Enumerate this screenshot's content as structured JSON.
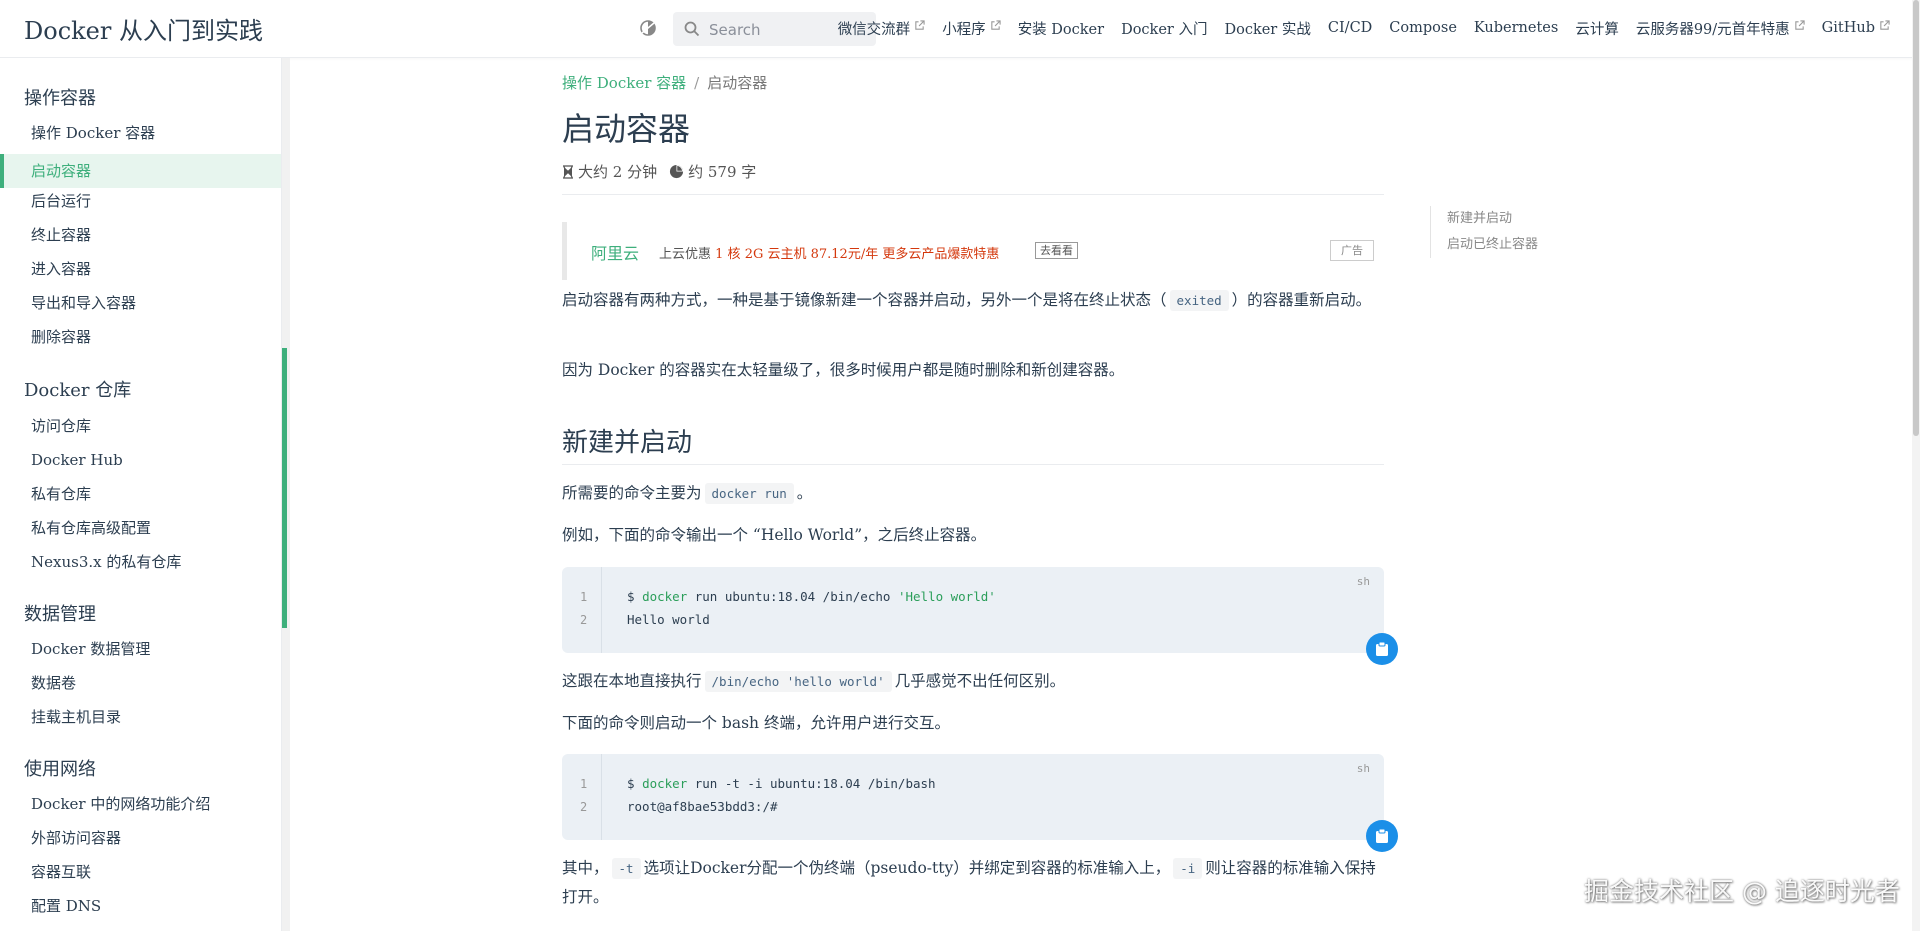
{
  "navbar": {
    "site_name": "Docker 从入门到实践",
    "search_placeholder": "Search",
    "links": [
      {
        "label": "微信交流群",
        "external": true
      },
      {
        "label": "小程序",
        "external": true
      },
      {
        "label": "安装 Docker",
        "external": false
      },
      {
        "label": "Docker 入门",
        "external": false
      },
      {
        "label": "Docker 实战",
        "external": false
      },
      {
        "label": "CI/CD",
        "external": false
      },
      {
        "label": "Compose",
        "external": false
      },
      {
        "label": "Kubernetes",
        "external": false
      },
      {
        "label": "云计算",
        "external": false
      },
      {
        "label": "云服务器99/元首年特惠",
        "external": true
      },
      {
        "label": "GitHub",
        "external": true
      }
    ]
  },
  "sidebar": {
    "groups": [
      {
        "title": "操作容器",
        "items": [
          "操作 Docker 容器",
          "启动容器",
          "后台运行",
          "终止容器",
          "进入容器",
          "导出和导入容器",
          "删除容器"
        ]
      },
      {
        "title": "Docker 仓库",
        "items": [
          "访问仓库",
          "Docker Hub",
          "私有仓库",
          "私有仓库高级配置",
          "Nexus3.x 的私有仓库"
        ]
      },
      {
        "title": "数据管理",
        "items": [
          "Docker 数据管理",
          "数据卷",
          "挂载主机目录"
        ]
      },
      {
        "title": "使用网络",
        "items": [
          "Docker 中的网络功能介绍",
          "外部访问容器",
          "容器互联",
          "配置 DNS"
        ]
      }
    ],
    "active_item": "启动容器"
  },
  "breadcrumb": {
    "parent": "操作 Docker 容器",
    "separator": "/",
    "current": "启动容器"
  },
  "page": {
    "title": "启动容器",
    "read_time": "大约 2 分钟",
    "word_count": "约 579 字"
  },
  "ad": {
    "brand": "阿里云",
    "lead": "上云优惠",
    "highlight": "1 核 2G 云主机 87.12元/年 更多云产品爆款特惠",
    "button": "去看看",
    "tag": "广告"
  },
  "body": {
    "p1_a": "启动容器有两种方式，一种是基于镜像新建一个容器并启动，另外一个是将在终止状态（",
    "p1_code": "exited",
    "p1_b": "）的容器重新启动。",
    "p2": "因为 Docker 的容器实在太轻量级了，很多时候用户都是随时删除和新创建容器。",
    "h2_new": "新建并启动",
    "p3_a": "所需要的命令主要为",
    "p3_code": "docker run",
    "p3_b": "。",
    "p4": "例如，下面的命令输出一个 “Hello World”，之后终止容器。",
    "code1": {
      "lang": "sh",
      "line_numbers": [
        "1",
        "2"
      ],
      "l1_prompt": "$ ",
      "l1_cmd": "docker",
      "l1_rest": " run ubuntu:18.04 /bin/echo ",
      "l1_str": "'Hello world'",
      "l2": "Hello world"
    },
    "p5_a": "这跟在本地直接执行",
    "p5_code": "/bin/echo 'hello world'",
    "p5_b": "几乎感觉不出任何区别。",
    "p6": "下面的命令则启动一个 bash 终端，允许用户进行交互。",
    "code2": {
      "lang": "sh",
      "line_numbers": [
        "1",
        "2"
      ],
      "l1_prompt": "$ ",
      "l1_cmd": "docker",
      "l1_rest": " run -t -i ubuntu:18.04 /bin/bash",
      "l2": "root@af8bae53bdd3:/#"
    },
    "p7_a": "其中，",
    "p7_code1": "-t",
    "p7_b": "选项让Docker分配一个伪终端（pseudo-tty）并绑定到容器的标准输入上，",
    "p7_code2": "-i",
    "p7_c": "则让容器的标准输入保持打开。"
  },
  "toc": [
    "新建并启动",
    "启动已终止容器"
  ],
  "watermark": "掘金技术社区 @ 追逐时光者",
  "colors": {
    "accent": "#3eaf7c",
    "copy_button": "#1b8fe8",
    "ad_red": "#d4380d"
  }
}
